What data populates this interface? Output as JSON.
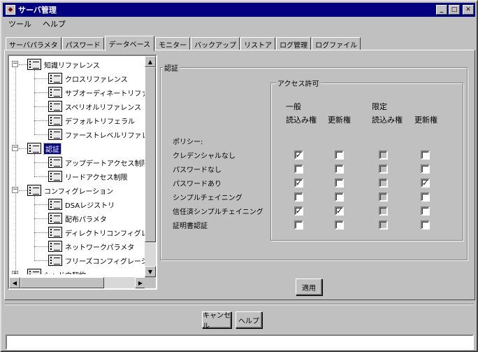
{
  "window": {
    "title": "サーバ管理"
  },
  "menu": [
    "ツール",
    "ヘルプ"
  ],
  "tabs": [
    {
      "label": "サーバパラメタ",
      "active": false
    },
    {
      "label": "パスワード",
      "active": false
    },
    {
      "label": "データベース",
      "active": true
    },
    {
      "label": "モニター",
      "active": false
    },
    {
      "label": "バックアップ",
      "active": false
    },
    {
      "label": "リストア",
      "active": false
    },
    {
      "label": "ログ管理",
      "active": false
    },
    {
      "label": "ログファイル",
      "active": false
    }
  ],
  "tree": [
    {
      "label": "知識リファレンス",
      "level": 0,
      "expander": "−"
    },
    {
      "label": "クロスリファレンス",
      "level": 1
    },
    {
      "label": "サブオーディネートリファレンス",
      "level": 1
    },
    {
      "label": "スペリオルリファレンス",
      "level": 1
    },
    {
      "label": "デフォルトリフェラル",
      "level": 1
    },
    {
      "label": "ファーストレベルリファレンス",
      "level": 1
    },
    {
      "label": "認証",
      "level": 0,
      "expander": "−",
      "selected": true
    },
    {
      "label": "アップデートアクセス制限",
      "level": 1
    },
    {
      "label": "リードアクセス制限",
      "level": 1
    },
    {
      "label": "コンフィグレーション",
      "level": 0,
      "expander": "−"
    },
    {
      "label": "DSAレジストリ",
      "level": 1
    },
    {
      "label": "配布パラメタ",
      "level": 1
    },
    {
      "label": "ディレクトリコンフィグレーション",
      "level": 1
    },
    {
      "label": "ネットワークパラメタ",
      "level": 1
    },
    {
      "label": "フリーズコンフィグレーション",
      "level": 1
    },
    {
      "label": "シャドウ契約",
      "level": 0,
      "expander": "+"
    }
  ],
  "auth": {
    "group_label": "認証",
    "access_label": "アクセス許可",
    "general_label": "一般",
    "limited_label": "限定",
    "read_label": "読込み権",
    "update_label": "更新権",
    "policy_label": "ポリシー:",
    "rows": [
      {
        "label": "クレデンシャルなし",
        "gen_read": true,
        "gen_update": false,
        "lim_read": false,
        "lim_update": false
      },
      {
        "label": "パスワードなし",
        "gen_read": false,
        "gen_update": false,
        "lim_read": false,
        "lim_update": false
      },
      {
        "label": "パスワードあり",
        "gen_read": true,
        "gen_update": false,
        "lim_read": false,
        "lim_update": true
      },
      {
        "label": "シンプルチェイニング",
        "gen_read": false,
        "gen_update": false,
        "lim_read": false,
        "lim_update": false
      },
      {
        "label": "信任済シンプルチェイニング",
        "gen_read": true,
        "gen_update": true,
        "lim_read": false,
        "lim_update": false
      },
      {
        "label": "証明書認証",
        "gen_read": false,
        "gen_update": false,
        "lim_read": false,
        "lim_update": false
      }
    ],
    "apply_label": "適用"
  },
  "footer": {
    "cancel_label": "キャンセル",
    "help_label": "ヘルプ"
  }
}
